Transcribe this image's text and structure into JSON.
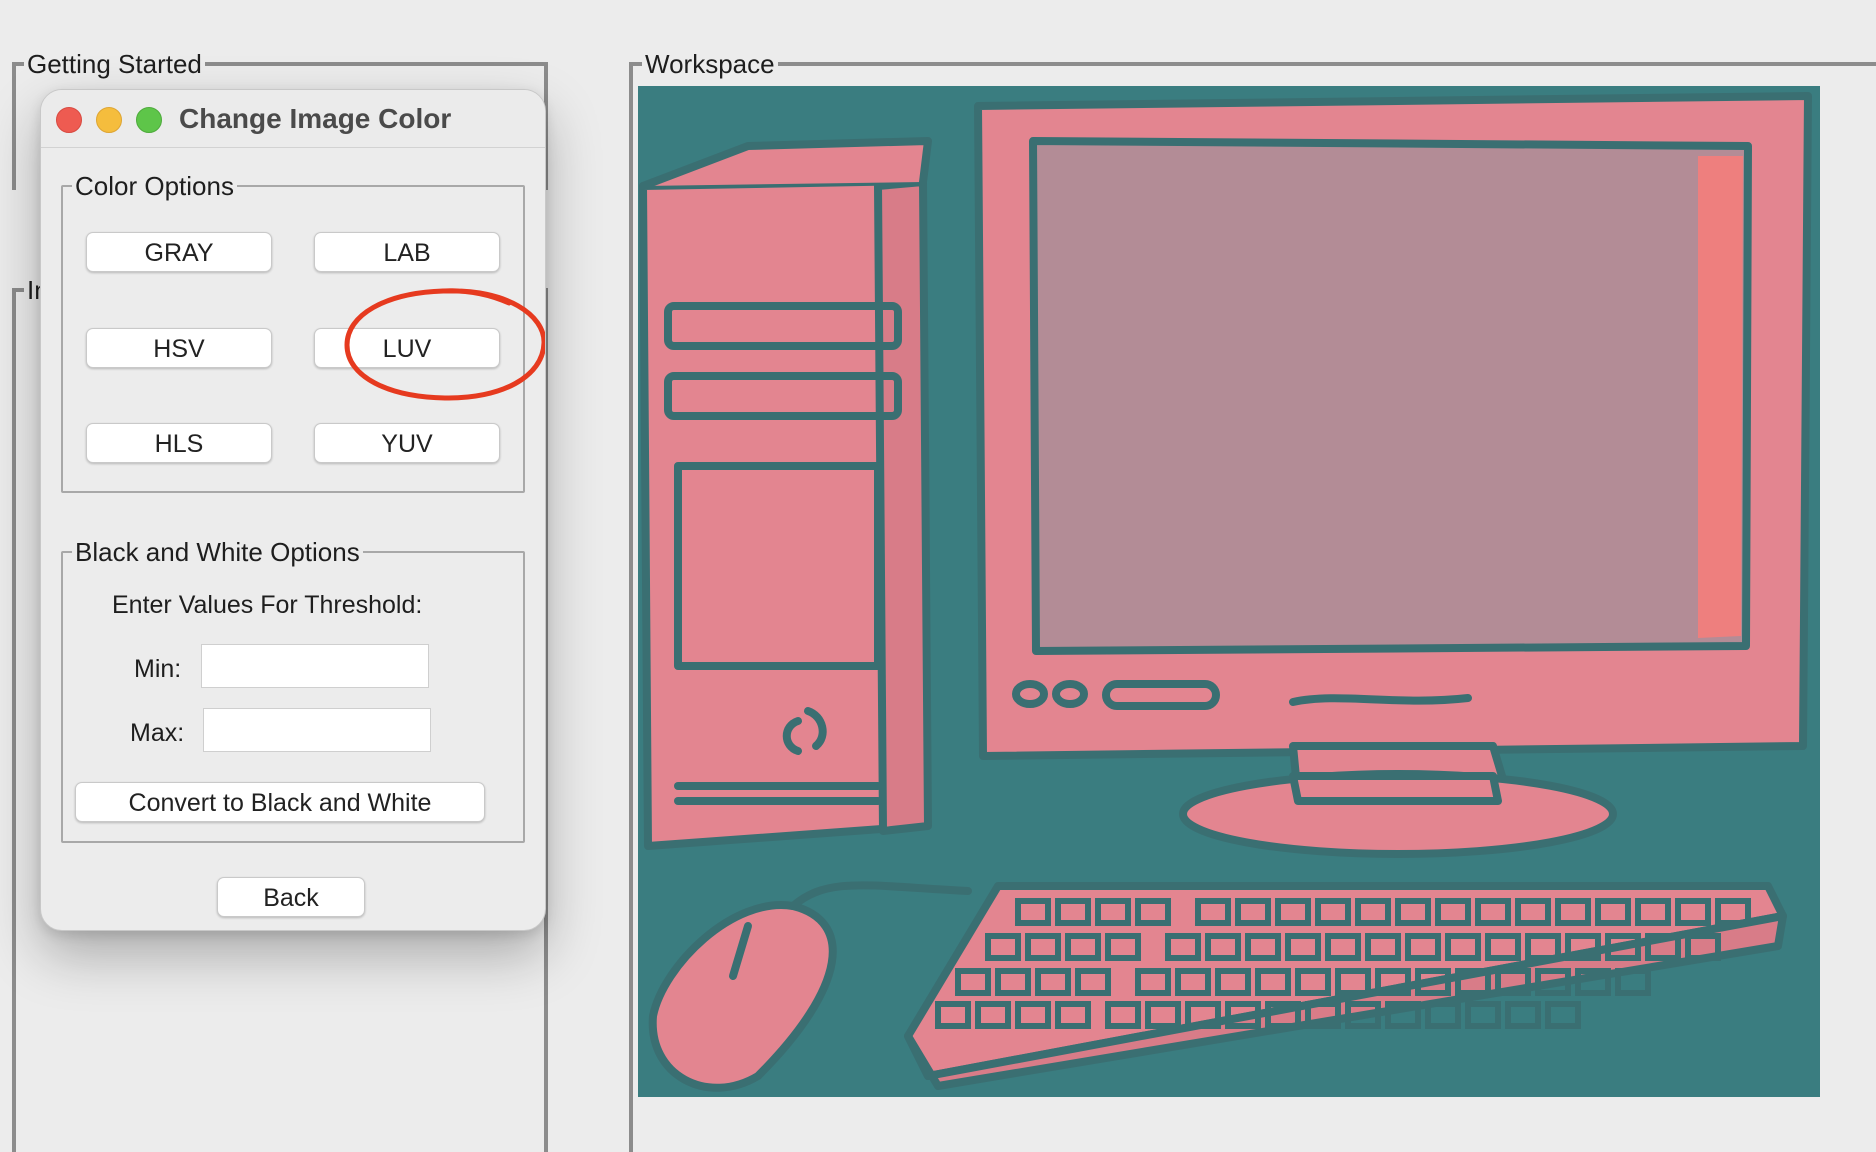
{
  "main": {
    "getting_started_title": "Getting Started",
    "second_frame_title": "In",
    "workspace_title": "Workspace"
  },
  "dialog": {
    "title": "Change Image Color",
    "color_options": {
      "title": "Color Options",
      "buttons": [
        "GRAY",
        "LAB",
        "HSV",
        "LUV",
        "HLS",
        "YUV"
      ],
      "highlighted": "LAB"
    },
    "bw_options": {
      "title": "Black and White Options",
      "prompt": "Enter Values For Threshold:",
      "min_label": "Min:",
      "max_label": "Max:",
      "min_value": "",
      "max_value": "",
      "convert_label": "Convert to Black and White"
    },
    "back_label": "Back"
  },
  "colors": {
    "close": "#ee5b51",
    "minimize": "#f5bd3d",
    "zoom": "#5ec549",
    "highlight": "#e63a1f",
    "image_background": "#3a7d80",
    "image_foreground": "#e38590"
  },
  "icons": {
    "workspace_image": "computer-illustration"
  }
}
